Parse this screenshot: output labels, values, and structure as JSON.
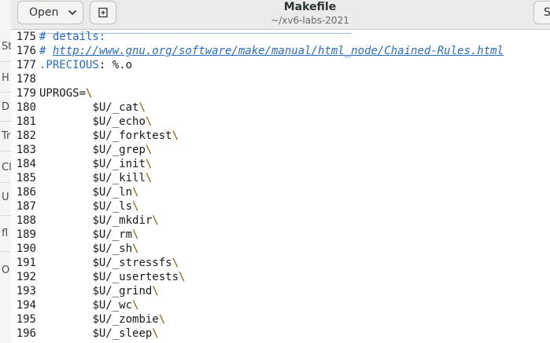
{
  "window": {
    "title": "Makefile",
    "subtitle": "~/xv6-labs-2021"
  },
  "toolbar": {
    "open_label": "Open",
    "save_label": "S"
  },
  "background_window": {
    "items": [
      "St",
      "H",
      "D",
      "Tr",
      "Cl",
      "U",
      "fl",
      "O"
    ]
  },
  "icons": {
    "open_dropdown": "chevron-down-icon",
    "new_document": "new-document-icon"
  },
  "colors": {
    "comment": "#2a6cc4",
    "escape": "#8a5a00",
    "headerbar": "#ebebeb"
  },
  "editor": {
    "lines": [
      {
        "n": "175",
        "comment": "# details:"
      },
      {
        "n": "176",
        "comment_prefix": "# ",
        "link": "http://www.gnu.org/software/make/manual/html_node/Chained-Rules.html"
      },
      {
        "n": "177",
        "target": ".PRECIOUS",
        "rest": ": %.o"
      },
      {
        "n": "178",
        "text": ""
      },
      {
        "n": "179",
        "var": "UPROGS=",
        "bs": "\\"
      },
      {
        "n": "180",
        "item": "$U/_cat",
        "bs": "\\"
      },
      {
        "n": "181",
        "item": "$U/_echo",
        "bs": "\\"
      },
      {
        "n": "182",
        "item": "$U/_forktest",
        "bs": "\\"
      },
      {
        "n": "183",
        "item": "$U/_grep",
        "bs": "\\"
      },
      {
        "n": "184",
        "item": "$U/_init",
        "bs": "\\"
      },
      {
        "n": "185",
        "item": "$U/_kill",
        "bs": "\\"
      },
      {
        "n": "186",
        "item": "$U/_ln",
        "bs": "\\"
      },
      {
        "n": "187",
        "item": "$U/_ls",
        "bs": "\\"
      },
      {
        "n": "188",
        "item": "$U/_mkdir",
        "bs": "\\"
      },
      {
        "n": "189",
        "item": "$U/_rm",
        "bs": "\\"
      },
      {
        "n": "190",
        "item": "$U/_sh",
        "bs": "\\"
      },
      {
        "n": "191",
        "item": "$U/_stressfs",
        "bs": "\\"
      },
      {
        "n": "192",
        "item": "$U/_usertests",
        "bs": "\\"
      },
      {
        "n": "193",
        "item": "$U/_grind",
        "bs": "\\"
      },
      {
        "n": "194",
        "item": "$U/_wc",
        "bs": "\\"
      },
      {
        "n": "195",
        "item": "$U/_zombie",
        "bs": "\\"
      },
      {
        "n": "196",
        "item": "$U/_sleep",
        "bs": "\\"
      }
    ]
  }
}
